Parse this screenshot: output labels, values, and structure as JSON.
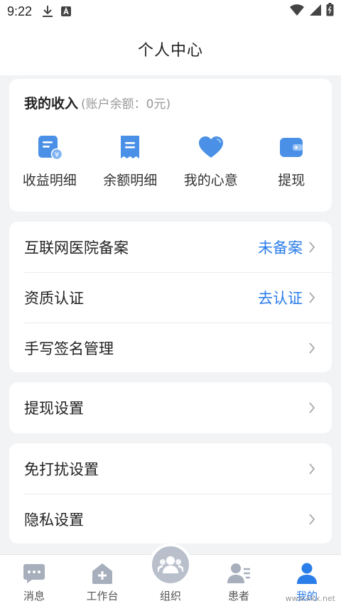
{
  "status_bar": {
    "time": "9:22"
  },
  "header": {
    "title": "个人中心"
  },
  "income": {
    "title": "我的收入",
    "balance_text": "(账户余额：0元)",
    "items": [
      {
        "label": "收益明细",
        "icon": "income-detail-icon"
      },
      {
        "label": "余额明细",
        "icon": "balance-receipt-icon"
      },
      {
        "label": "我的心意",
        "icon": "heart-icon"
      },
      {
        "label": "提现",
        "icon": "wallet-icon"
      }
    ]
  },
  "settings": {
    "group1": [
      {
        "label": "互联网医院备案",
        "value": "未备案"
      },
      {
        "label": "资质认证",
        "value": "去认证"
      },
      {
        "label": "手写签名管理",
        "value": ""
      }
    ],
    "group2": [
      {
        "label": "提现设置",
        "value": ""
      }
    ],
    "group3": [
      {
        "label": "免打扰设置",
        "value": ""
      },
      {
        "label": "隐私设置",
        "value": ""
      }
    ]
  },
  "tabs": [
    {
      "label": "消息",
      "icon": "message-icon"
    },
    {
      "label": "工作台",
      "icon": "workbench-icon"
    },
    {
      "label": "组织",
      "icon": "group-icon"
    },
    {
      "label": "患者",
      "icon": "patient-icon"
    },
    {
      "label": "我的",
      "icon": "profile-icon",
      "active": true
    }
  ],
  "watermark": "www.kkx.net",
  "colors": {
    "accent": "#2b7de9",
    "icon_blue": "#4a90e6",
    "inactive_icon": "#a7afbd"
  }
}
